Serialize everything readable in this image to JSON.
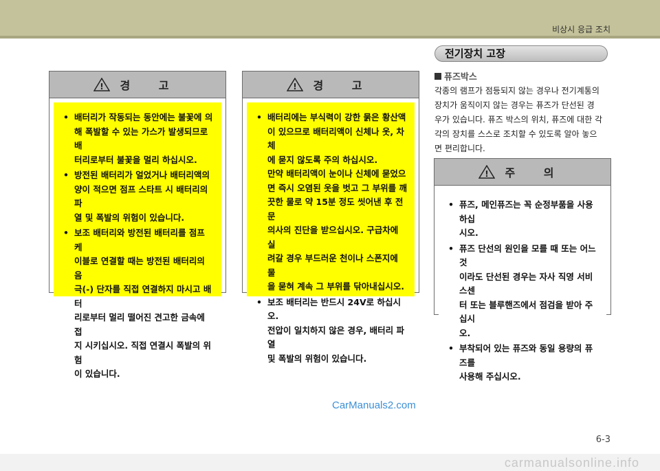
{
  "header": {
    "title": "비상시 응급 조치"
  },
  "warning1": {
    "title": "경 고",
    "items": [
      [
        "배터리가 작동되는 동안에는 불꽃에 의",
        "해 폭발할 수 있는 가스가 발생되므로 배",
        "터리로부터 불꽃을 멀리 하십시오."
      ],
      [
        "방전된 배터리가 얼었거나 배터리액의",
        "양이 적으면 점프 스타트 시 배터리의 파",
        "열 및 폭발의 위험이 있습니다."
      ],
      [
        "보조 배터리와 방전된 배터리를 점프 케",
        "이블로 연결할 때는 방전된 배터리의 음",
        "극(-) 단자를 직접 연결하지 마시고 배터",
        "리로부터 멀리 떨어진 견고한 금속에 접",
        "지 시키십시오. 직접 연결시 폭발의 위험",
        "이 있습니다."
      ]
    ]
  },
  "warning2": {
    "title": "경 고",
    "items": [
      [
        "배터리에는 부식력이 강한 묽은 황산액",
        "이 있으므로 배터리액이 신체나 옷, 차체",
        "에 묻지 않도록 주의 하십시오.",
        "만약 배터리액이 눈이나 신체에 묻었으",
        "면 즉시 오염된 옷을 벗고 그 부위를 깨",
        "끗한 물로 약 15분 정도 씻어낸 후 전문",
        "의사의 진단을 받으십시오. 구급차에 실",
        "려갈 경우 부드러운 천이나 스폰지에 물",
        "을 묻혀 계속 그 부위를 닦아내십시오."
      ],
      [
        "보조 배터리는 반드시 24V로 하십시오.",
        "전압이 일치하지 않은 경우, 배터리 파열",
        "및 폭발의 위험이 있습니다."
      ]
    ]
  },
  "section": {
    "title": "전기장치 고장"
  },
  "fuse": {
    "subtitle": "퓨즈박스",
    "paragraph": [
      "각종의 램프가 점등되지 않는 경우나 전기계통의",
      "장치가 움직이지 않는 경우는 퓨즈가 단선된 경",
      "우가 있습니다. 퓨즈 박스의 위치, 퓨즈에 대한 각",
      "각의 장치를 스스로 조치할 수 있도록 알아 놓으",
      "면 편리합니다."
    ]
  },
  "caution": {
    "title": "주 의",
    "items": [
      [
        "퓨즈, 메인퓨즈는 꼭 순정부품을 사용하십",
        "시오."
      ],
      [
        "퓨즈 단선의 원인을 모를 때 또는 어느 것",
        "이라도 단선된 경우는 자사 직영 서비스센",
        "터 또는 블루핸즈에서 점검을 받아 주십시",
        "오."
      ],
      [
        "부착되어 있는 퓨즈와 동일 용량의 퓨즈를",
        "사용해 주십시오."
      ]
    ]
  },
  "watermark": "CarManuals2.com",
  "page_number": "6-3",
  "footer": "carmanualsonline.info",
  "colors": {
    "warning_bg": "#ffff00",
    "header_band": "#c4c29a",
    "panel_header": "#b9b9b9"
  }
}
